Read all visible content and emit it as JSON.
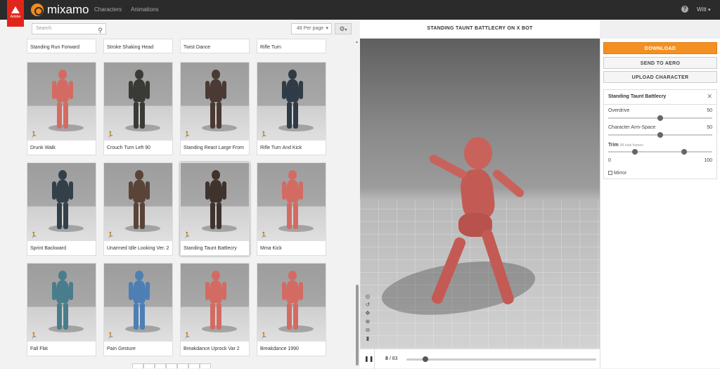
{
  "brand": {
    "adobe_label": "Adobe",
    "name": "mixamo"
  },
  "nav": {
    "characters": "Characters",
    "animations": "Animations"
  },
  "user": {
    "name": "Witt"
  },
  "search": {
    "placeholder": "Search"
  },
  "per_page": {
    "value": "48 Per page"
  },
  "cards_top_row": [
    "Standing Run Forward",
    "Stroke Shaking Head",
    "Twist Dance",
    "Rifle Turn"
  ],
  "cards": [
    {
      "label": "Drunk Walk"
    },
    {
      "label": "Crouch Turn Left 90"
    },
    {
      "label": "Standing React Large From"
    },
    {
      "label": "Rifle Turn And Kick"
    },
    {
      "label": "Sprint Backward"
    },
    {
      "label": "Unarmed Idle Looking Ver. 2"
    },
    {
      "label": "Standing Taunt Battlecry"
    },
    {
      "label": "Mma Kick"
    },
    {
      "label": "Fall Flat"
    },
    {
      "label": "Pain Gesture"
    },
    {
      "label": "Breakdance Uprock Var 2"
    },
    {
      "label": "Breakdance 1990"
    }
  ],
  "viewer": {
    "title": "STANDING TAUNT BATTLECRY ON X BOT",
    "frame_current": "8",
    "frame_total": "/ 83",
    "progress": 0.1
  },
  "panel": {
    "download": "DOWNLOAD",
    "send_to_aero": "SEND TO AERO",
    "upload_character": "UPLOAD CHARACTER",
    "settings_title": "Standing Taunt Battlecry",
    "overdrive_label": "Overdrive",
    "overdrive_value": "50",
    "armspace_label": "Character Arm-Space",
    "armspace_value": "50",
    "trim_label": "Trim",
    "trim_sub": "98 total frames",
    "trim_min": "0",
    "trim_max": "100",
    "mirror_label": "Mirror"
  },
  "colors": {
    "accent": "#f39021",
    "mannequin": "#d46b63",
    "topbar": "#2b2b2b"
  }
}
